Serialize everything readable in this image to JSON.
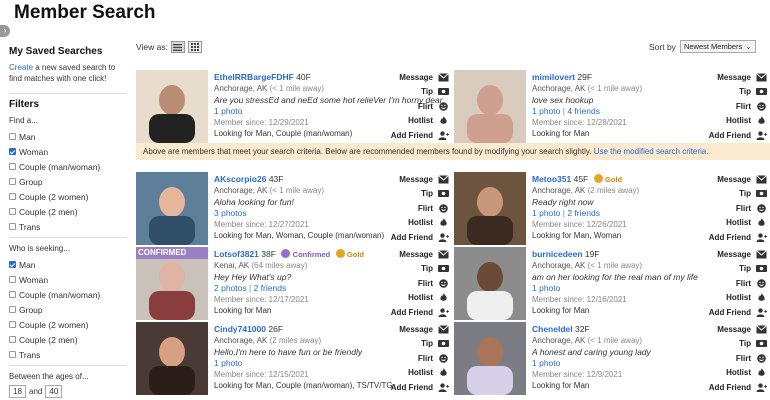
{
  "page_title": "Member Search",
  "sidebar": {
    "saved_heading": "My Saved Searches",
    "create_link": "Create",
    "create_text": " a new saved search to find matches with one click!",
    "filters_heading": "Filters",
    "find_label": "Find a...",
    "find_options": [
      {
        "label": "Man",
        "checked": false
      },
      {
        "label": "Woman",
        "checked": true
      },
      {
        "label": "Couple (man/woman)",
        "checked": false
      },
      {
        "label": "Group",
        "checked": false
      },
      {
        "label": "Couple (2 women)",
        "checked": false
      },
      {
        "label": "Couple (2 men)",
        "checked": false
      },
      {
        "label": "Trans",
        "checked": false
      }
    ],
    "seeking_label": "Who is seeking...",
    "seeking_options": [
      {
        "label": "Man",
        "checked": true
      },
      {
        "label": "Woman",
        "checked": false
      },
      {
        "label": "Couple (man/woman)",
        "checked": false
      },
      {
        "label": "Group",
        "checked": false
      },
      {
        "label": "Couple (2 women)",
        "checked": false
      },
      {
        "label": "Couple (2 men)",
        "checked": false
      },
      {
        "label": "Trans",
        "checked": false
      }
    ],
    "ages_label": "Between the ages of...",
    "age_min": "18",
    "age_and": "and",
    "age_max": "40"
  },
  "toolbar": {
    "view_as_label": "View as:",
    "sort_label": "Sort by",
    "sort_value": "Newest Members"
  },
  "actions": {
    "message": "Message",
    "tip": "Tip",
    "flirt": "Flirt",
    "hotlist": "Hotlist",
    "add_friend": "Add Friend"
  },
  "banner": {
    "text": "Above are members that meet your search criteria. Below are recommended members found by modifying your search slightly. ",
    "link": "Use the modified search criteria."
  },
  "badges": {
    "confirmed": "Confirmed",
    "gold": "Gold",
    "confirmed_strip": "CONFIRMED"
  },
  "members": [
    {
      "username": "EthelRRBargeFDHF",
      "gender_age": "40F",
      "location": "Anchorage, AK",
      "distance": "(< 1 mile away)",
      "tagline": "Are you stressEd and neEd some hot relieVer I'm horny dear",
      "photos": "1 photo",
      "friends": "",
      "since": "Member since: 12/29/2021",
      "looking": "Looking for Man, Couple (man/woman)",
      "confirmed": false,
      "gold": false
    },
    {
      "username": "mimilovert",
      "gender_age": "29F",
      "location": "Anchorage, AK",
      "distance": "(< 1 mile away)",
      "tagline": "love sex hookup",
      "photos": "1 photo",
      "friends": "4 friends",
      "since": "Member since: 12/28/2021",
      "looking": "Looking for Man",
      "confirmed": false,
      "gold": false
    },
    {
      "username": "AKscorpio26",
      "gender_age": "43F",
      "location": "Anchorage, AK",
      "distance": "(< 1 mile away)",
      "tagline": "Aloha looking for fun!",
      "photos": "3 photos",
      "friends": "",
      "since": "Member since: 12/27/2021",
      "looking": "Looking for Man, Woman, Couple (man/woman)",
      "confirmed": false,
      "gold": false
    },
    {
      "username": "Metoo351",
      "gender_age": "45F",
      "location": "Anchorage, AK",
      "distance": "(2 miles away)",
      "tagline": "Ready right now",
      "photos": "1 photo",
      "friends": "2 friends",
      "since": "Member since: 12/26/2021",
      "looking": "Looking for Man, Woman",
      "confirmed": false,
      "gold": true
    },
    {
      "username": "Lotsof3821",
      "gender_age": "38F",
      "location": "Kenai, AK",
      "distance": "(64 miles away)",
      "tagline": "Hey Hey What's up?",
      "photos": "2 photos",
      "friends": "2 friends",
      "since": "Member since: 12/17/2021",
      "looking": "Looking for Man",
      "confirmed": true,
      "gold": true
    },
    {
      "username": "burnicedeen",
      "gender_age": "19F",
      "location": "Anchorage, AK",
      "distance": "(< 1 mile away)",
      "tagline": "am on her looking for the real man of my life",
      "photos": "1 photo",
      "friends": "",
      "since": "Member since: 12/16/2021",
      "looking": "Looking for Man",
      "confirmed": false,
      "gold": false
    },
    {
      "username": "Cindy741000",
      "gender_age": "26F",
      "location": "Anchorage, AK",
      "distance": "(2 miles away)",
      "tagline": "Hello,I'm here to have fun or be friendly",
      "photos": "1 photo",
      "friends": "",
      "since": "Member since: 12/15/2021",
      "looking": "Looking for Man, Couple (man/woman), TS/TV/TG",
      "confirmed": false,
      "gold": false
    },
    {
      "username": "Cheneldel",
      "gender_age": "32F",
      "location": "Anchorage, AK",
      "distance": "(< 1 mile away)",
      "tagline": "A honest and caring young lady",
      "photos": "1 photo",
      "friends": "",
      "since": "Member since: 12/9/2021",
      "looking": "Looking for Man",
      "confirmed": false,
      "gold": false
    }
  ],
  "colors": {
    "link": "#2a6bcc",
    "banner_bg": "#fbead0",
    "confirmed": "#9b6fc9",
    "gold": "#e3a524"
  }
}
